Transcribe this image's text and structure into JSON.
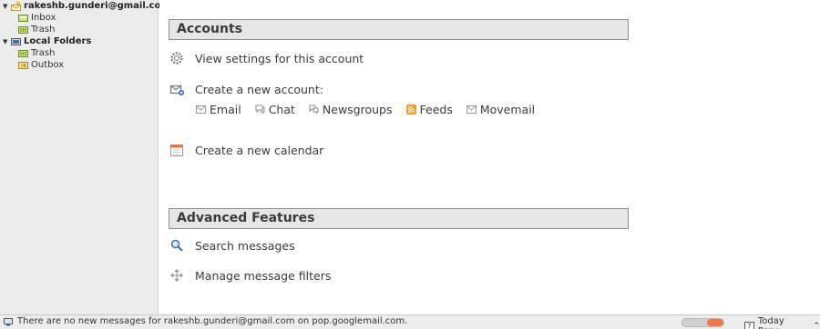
{
  "sidebar": {
    "account": {
      "label": "rakeshb.gunderi@gmail.com",
      "folders": [
        "Inbox",
        "Trash"
      ]
    },
    "local": {
      "label": "Local Folders",
      "folders": [
        "Trash",
        "Outbox"
      ]
    }
  },
  "main": {
    "accounts_section": {
      "title": "Accounts",
      "view_settings": "View settings for this account",
      "create_account": "Create a new account:",
      "account_types": [
        "Email",
        "Chat",
        "Newsgroups",
        "Feeds",
        "Movemail"
      ],
      "create_calendar": "Create a new calendar"
    },
    "advanced_section": {
      "title": "Advanced Features",
      "search": "Search messages",
      "filters": "Manage message filters"
    }
  },
  "statusbar": {
    "message": "There are no new messages for rakeshb.gunderi@gmail.com on pop.googlemail.com.",
    "progress_fraction": 0.4,
    "today_pane_label": "Today Pane",
    "today_day": "7"
  },
  "colors": {
    "feeds_accent": "#f0a030",
    "progress": "#f07746",
    "folder": "#8cb844",
    "section_bg": "#e6e6e6"
  }
}
